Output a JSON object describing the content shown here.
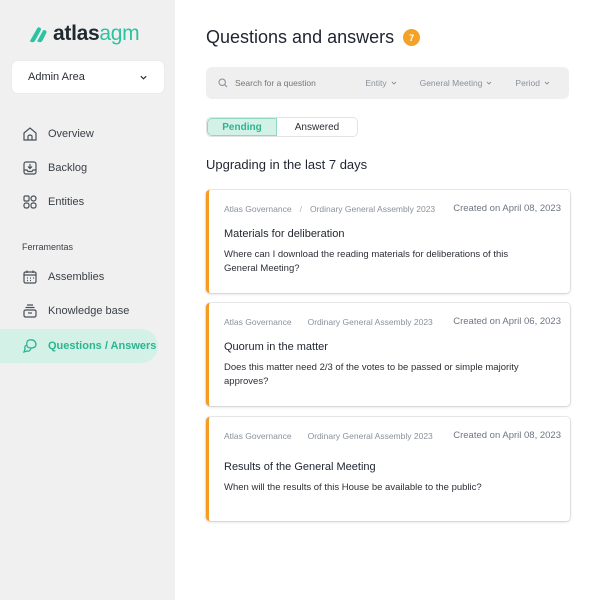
{
  "app": {
    "logo_primary": "atlas",
    "logo_secondary": "agm",
    "brand_color": "#2bc3a0",
    "accent_color": "#f59d22"
  },
  "sidebar": {
    "area_select": {
      "label": "Admin Area",
      "icon": "chevron-down-icon"
    },
    "items": [
      {
        "label": "Overview",
        "icon": "home-icon",
        "active": false
      },
      {
        "label": "Backlog",
        "icon": "inbox-download-icon",
        "active": false
      },
      {
        "label": "Entities",
        "icon": "grid-shapes-icon",
        "active": false
      }
    ],
    "section_label": "Ferramentas",
    "tools": [
      {
        "label": "Assemblies",
        "icon": "calendar-icon",
        "active": false
      },
      {
        "label": "Knowledge base",
        "icon": "archive-icon",
        "active": false
      },
      {
        "label": "Questions / Answers",
        "icon": "chat-bubbles-icon",
        "active": true
      }
    ]
  },
  "header": {
    "title": "Questions and answers",
    "count_badge": "7"
  },
  "search": {
    "placeholder": "Search for a question",
    "filters": [
      {
        "label": "Entity"
      },
      {
        "label": "General Meeting"
      },
      {
        "label": "Period"
      }
    ]
  },
  "tabs": [
    {
      "label": "Pending",
      "active": true
    },
    {
      "label": "Answered",
      "active": false
    }
  ],
  "section_title": "Upgrading in the last 7 days",
  "questions": [
    {
      "entity": "Atlas Governance",
      "separator": "/",
      "meeting": "Ordinary General Assembly 2023",
      "created": "Created on April 08, 2023",
      "title": "Materials for deliberation",
      "body": "Where can I download the reading materials for deliberations of this General Meeting?"
    },
    {
      "entity": "Atlas Governance",
      "separator": "",
      "meeting": "Ordinary General Assembly 2023",
      "created": "Created on April 06, 2023",
      "title": "Quorum in the matter",
      "body": "Does this matter need 2/3 of the votes to be passed or simple majority approves?"
    },
    {
      "entity": "Atlas Governance",
      "separator": "",
      "meeting": "Ordinary General Assembly 2023",
      "created": "Created on April 08, 2023",
      "title": "Results of the General Meeting",
      "body": "When will the results of this House be available to the public?"
    }
  ]
}
